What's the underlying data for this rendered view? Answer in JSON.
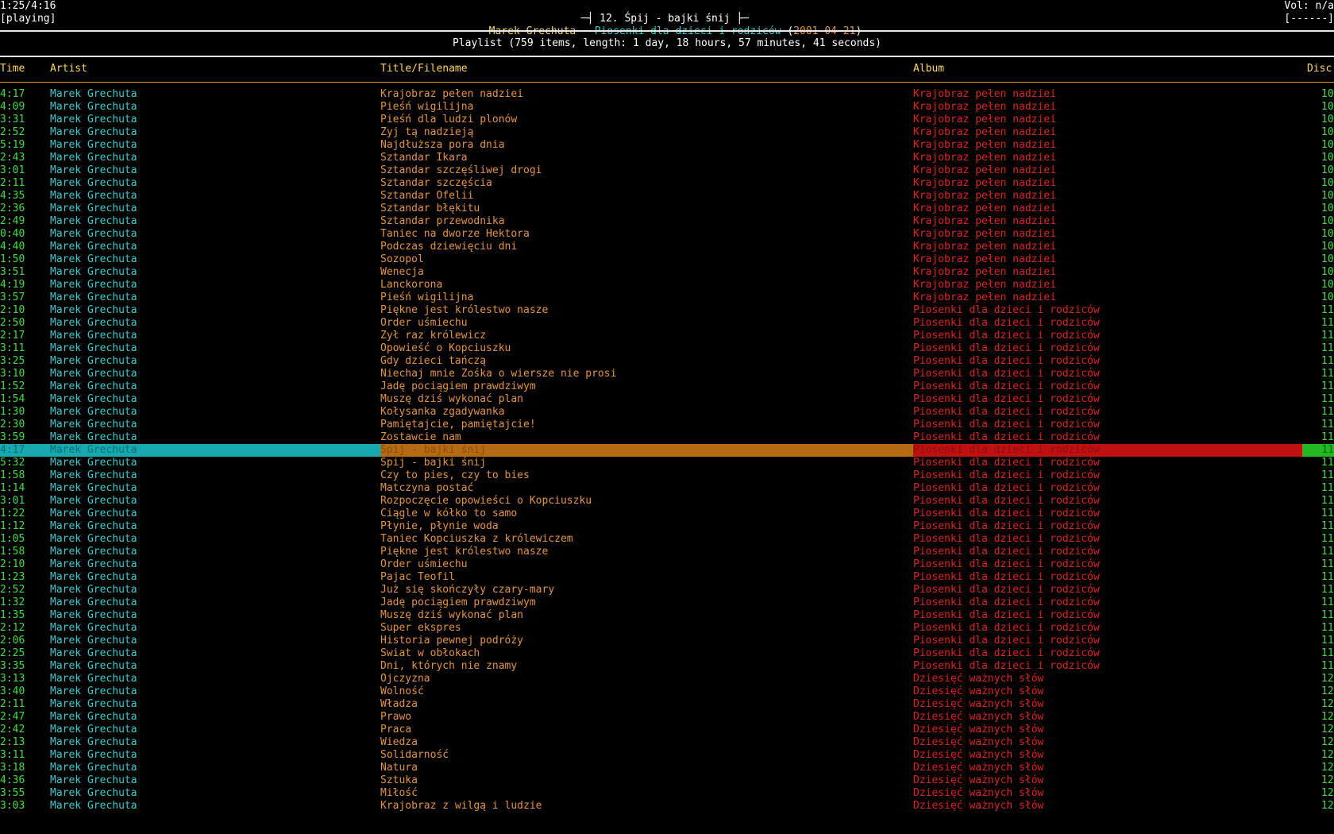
{
  "top": {
    "elapsed_total": "1:25/4:16",
    "state": "[playing]",
    "title_bar": "12. Śpij - bajki śnij",
    "np_artist": "Marek Grechuta",
    "np_dash": " - ",
    "np_album": "Piosenki dla dzieci i rodziców",
    "np_year_open": " (",
    "np_year": "2001-04-21",
    "np_year_close": ")",
    "volume": "Vol: n/a",
    "volume_bar": "[------]"
  },
  "playlist": {
    "header": "Playlist (759 items, length: 1 day, 18 hours, 57 minutes, 41 seconds)",
    "columns": {
      "time": "Time",
      "artist": "Artist",
      "title": "Title/Filename",
      "album": "Album",
      "disc": "Disc"
    },
    "selected_index": 28,
    "rows": [
      [
        "4:17",
        "Marek Grechuta",
        "Krajobraz pełen nadziei",
        "Krajobraz pełen nadziei",
        "10"
      ],
      [
        "4:09",
        "Marek Grechuta",
        "Pieśń wigilijna",
        "Krajobraz pełen nadziei",
        "10"
      ],
      [
        "3:31",
        "Marek Grechuta",
        "Pieśń dla ludzi plonów",
        "Krajobraz pełen nadziei",
        "10"
      ],
      [
        "2:52",
        "Marek Grechuta",
        "Żyj tą nadzieją",
        "Krajobraz pełen nadziei",
        "10"
      ],
      [
        "5:19",
        "Marek Grechuta",
        "Najdłuższa pora dnia",
        "Krajobraz pełen nadziei",
        "10"
      ],
      [
        "2:43",
        "Marek Grechuta",
        "Sztandar Ikara",
        "Krajobraz pełen nadziei",
        "10"
      ],
      [
        "3:01",
        "Marek Grechuta",
        "Sztandar szczęśliwej drogi",
        "Krajobraz pełen nadziei",
        "10"
      ],
      [
        "2:11",
        "Marek Grechuta",
        "Sztandar szczęścia",
        "Krajobraz pełen nadziei",
        "10"
      ],
      [
        "4:35",
        "Marek Grechuta",
        "Sztandar Ofelii",
        "Krajobraz pełen nadziei",
        "10"
      ],
      [
        "2:36",
        "Marek Grechuta",
        "Sztandar błękitu",
        "Krajobraz pełen nadziei",
        "10"
      ],
      [
        "2:49",
        "Marek Grechuta",
        "Sztandar przewodnika",
        "Krajobraz pełen nadziei",
        "10"
      ],
      [
        "0:40",
        "Marek Grechuta",
        "Taniec na dworze Hektora",
        "Krajobraz pełen nadziei",
        "10"
      ],
      [
        "4:40",
        "Marek Grechuta",
        "Podczas dziewięciu dni",
        "Krajobraz pełen nadziei",
        "10"
      ],
      [
        "1:50",
        "Marek Grechuta",
        "Sozopol",
        "Krajobraz pełen nadziei",
        "10"
      ],
      [
        "3:51",
        "Marek Grechuta",
        "Wenecja",
        "Krajobraz pełen nadziei",
        "10"
      ],
      [
        "4:19",
        "Marek Grechuta",
        "Lanckorona",
        "Krajobraz pełen nadziei",
        "10"
      ],
      [
        "3:57",
        "Marek Grechuta",
        "Pieśń wigilijna",
        "Krajobraz pełen nadziei",
        "10"
      ],
      [
        "2:10",
        "Marek Grechuta",
        "Piękne jest królestwo nasze",
        "Piosenki dla dzieci i rodziców",
        "11"
      ],
      [
        "2:50",
        "Marek Grechuta",
        "Order uśmiechu",
        "Piosenki dla dzieci i rodziców",
        "11"
      ],
      [
        "2:17",
        "Marek Grechuta",
        "Żył raz królewicz",
        "Piosenki dla dzieci i rodziców",
        "11"
      ],
      [
        "3:11",
        "Marek Grechuta",
        "Opowieść o Kopciuszku",
        "Piosenki dla dzieci i rodziców",
        "11"
      ],
      [
        "3:25",
        "Marek Grechuta",
        "Gdy dzieci tańczą",
        "Piosenki dla dzieci i rodziców",
        "11"
      ],
      [
        "3:10",
        "Marek Grechuta",
        "Niechaj mnie Zośka o wiersze nie prosi",
        "Piosenki dla dzieci i rodziców",
        "11"
      ],
      [
        "1:52",
        "Marek Grechuta",
        "Jadę pociągiem prawdziwym",
        "Piosenki dla dzieci i rodziców",
        "11"
      ],
      [
        "1:54",
        "Marek Grechuta",
        "Muszę dziś wykonać plan",
        "Piosenki dla dzieci i rodziców",
        "11"
      ],
      [
        "1:30",
        "Marek Grechuta",
        "Kołysanka zgadywanka",
        "Piosenki dla dzieci i rodziców",
        "11"
      ],
      [
        "2:30",
        "Marek Grechuta",
        "Pamiętajcie, pamiętajcie!",
        "Piosenki dla dzieci i rodziców",
        "11"
      ],
      [
        "3:59",
        "Marek Grechuta",
        "Zostawcie nam",
        "Piosenki dla dzieci i rodziców",
        "11"
      ],
      [
        "4:17",
        "Marek Grechuta",
        "Śpij - bajki śnij",
        "Piosenki dla dzieci i rodziców",
        "11"
      ],
      [
        "5:32",
        "Marek Grechuta",
        "Śpij - bajki śnij",
        "Piosenki dla dzieci i rodziców",
        "11"
      ],
      [
        "1:58",
        "Marek Grechuta",
        "Czy to pies, czy to bies",
        "Piosenki dla dzieci i rodziców",
        "11"
      ],
      [
        "1:14",
        "Marek Grechuta",
        "Matczyna postać",
        "Piosenki dla dzieci i rodziców",
        "11"
      ],
      [
        "3:01",
        "Marek Grechuta",
        "Rozpoczęcie opowieści o Kopciuszku",
        "Piosenki dla dzieci i rodziców",
        "11"
      ],
      [
        "1:22",
        "Marek Grechuta",
        "Ciągle w kółko to samo",
        "Piosenki dla dzieci i rodziców",
        "11"
      ],
      [
        "1:12",
        "Marek Grechuta",
        "Płynie, płynie woda",
        "Piosenki dla dzieci i rodziców",
        "11"
      ],
      [
        "1:05",
        "Marek Grechuta",
        "Taniec Kopciuszka z królewiczem",
        "Piosenki dla dzieci i rodziców",
        "11"
      ],
      [
        "1:58",
        "Marek Grechuta",
        "Piękne jest królestwo nasze",
        "Piosenki dla dzieci i rodziców",
        "11"
      ],
      [
        "2:10",
        "Marek Grechuta",
        "Order uśmiechu",
        "Piosenki dla dzieci i rodziców",
        "11"
      ],
      [
        "1:23",
        "Marek Grechuta",
        "Pajac Teofil",
        "Piosenki dla dzieci i rodziców",
        "11"
      ],
      [
        "2:52",
        "Marek Grechuta",
        "Już się skończyły czary-mary",
        "Piosenki dla dzieci i rodziców",
        "11"
      ],
      [
        "1:32",
        "Marek Grechuta",
        "Jadę pociągiem prawdziwym",
        "Piosenki dla dzieci i rodziców",
        "11"
      ],
      [
        "1:35",
        "Marek Grechuta",
        "Muszę dziś wykonać plan",
        "Piosenki dla dzieci i rodziców",
        "11"
      ],
      [
        "2:12",
        "Marek Grechuta",
        "Super ekspres",
        "Piosenki dla dzieci i rodziców",
        "11"
      ],
      [
        "2:06",
        "Marek Grechuta",
        "Historia pewnej podróży",
        "Piosenki dla dzieci i rodziców",
        "11"
      ],
      [
        "2:25",
        "Marek Grechuta",
        "Świat w obłokach",
        "Piosenki dla dzieci i rodziców",
        "11"
      ],
      [
        "3:35",
        "Marek Grechuta",
        "Dni, których nie znamy",
        "Piosenki dla dzieci i rodziców",
        "11"
      ],
      [
        "3:13",
        "Marek Grechuta",
        "Ojczyzna",
        "Dziesięć ważnych słów",
        "12"
      ],
      [
        "3:40",
        "Marek Grechuta",
        "Wolność",
        "Dziesięć ważnych słów",
        "12"
      ],
      [
        "2:11",
        "Marek Grechuta",
        "Władza",
        "Dziesięć ważnych słów",
        "12"
      ],
      [
        "2:47",
        "Marek Grechuta",
        "Prawo",
        "Dziesięć ważnych słów",
        "12"
      ],
      [
        "2:42",
        "Marek Grechuta",
        "Praca",
        "Dziesięć ważnych słów",
        "12"
      ],
      [
        "2:13",
        "Marek Grechuta",
        "Wiedza",
        "Dziesięć ważnych słów",
        "12"
      ],
      [
        "3:11",
        "Marek Grechuta",
        "Solidarność",
        "Dziesięć ważnych słów",
        "12"
      ],
      [
        "3:18",
        "Marek Grechuta",
        "Natura",
        "Dziesięć ważnych słów",
        "12"
      ],
      [
        "4:36",
        "Marek Grechuta",
        "Sztuka",
        "Dziesięć ważnych słów",
        "12"
      ],
      [
        "3:55",
        "Marek Grechuta",
        "Miłość",
        "Dziesięć ważnych słów",
        "12"
      ],
      [
        "3:03",
        "Marek Grechuta",
        "Krajobraz z wilgą i ludzie",
        "Dziesięć ważnych słów",
        "12"
      ]
    ]
  },
  "progress": {
    "fraction": 0.34,
    "bar_text": "=========================================================================|"
  }
}
